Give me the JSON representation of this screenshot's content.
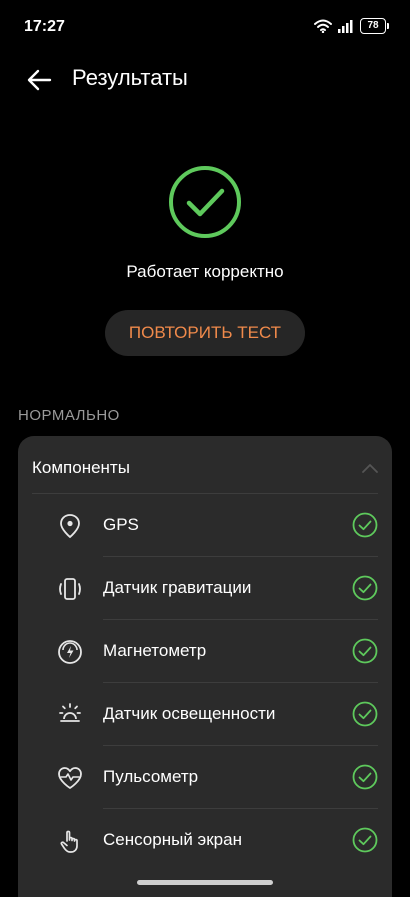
{
  "status_bar": {
    "time": "17:27",
    "battery": "78"
  },
  "app_bar": {
    "title": "Результаты"
  },
  "result": {
    "message": "Работает корректно"
  },
  "retry_button": {
    "label": "ПОВТОРИТЬ ТЕСТ"
  },
  "section": {
    "header": "НОРМАЛЬНО"
  },
  "components": {
    "title": "Компоненты",
    "items": [
      {
        "label": "GPS",
        "icon": "location-pin-icon",
        "status": "ok"
      },
      {
        "label": "Датчик гравитации",
        "icon": "phone-rotate-icon",
        "status": "ok"
      },
      {
        "label": "Магнетометр",
        "icon": "compass-bolt-icon",
        "status": "ok"
      },
      {
        "label": "Датчик освещенности",
        "icon": "sun-icon",
        "status": "ok"
      },
      {
        "label": "Пульсометр",
        "icon": "heart-pulse-icon",
        "status": "ok"
      },
      {
        "label": "Сенсорный экран",
        "icon": "touch-hand-icon",
        "status": "ok"
      }
    ]
  },
  "colors": {
    "accent_green": "#5ec95c",
    "accent_orange": "#f08a4b",
    "card_bg": "#2b2b2b",
    "background": "#000000"
  }
}
